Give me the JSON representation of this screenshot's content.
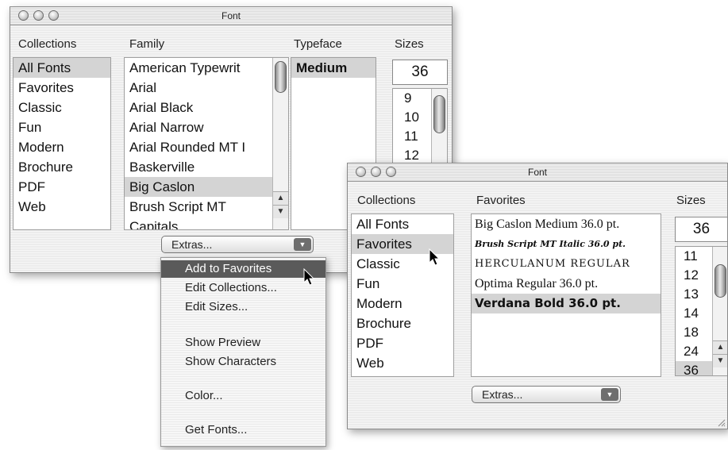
{
  "window1": {
    "title": "Font",
    "headers": {
      "collections": "Collections",
      "family": "Family",
      "typeface": "Typeface",
      "sizes": "Sizes"
    },
    "collections": [
      "All Fonts",
      "Favorites",
      "Classic",
      "Fun",
      "Modern",
      "Brochure",
      "PDF",
      "Web"
    ],
    "families": [
      "American Typewrit",
      "Arial",
      "Arial Black",
      "Arial Narrow",
      "Arial Rounded MT I",
      "Baskerville",
      "Big Caslon",
      "Brush Script MT",
      "Capitals"
    ],
    "typefaces": [
      "Medium"
    ],
    "size_value": "36",
    "sizes": [
      "9",
      "10",
      "11",
      "12"
    ],
    "extras_label": "Extras..."
  },
  "menu": {
    "items": [
      "Add to Favorites",
      "Edit Collections...",
      "Edit Sizes...",
      "Show Preview",
      "Show Characters",
      "Color...",
      "Get Fonts..."
    ]
  },
  "window2": {
    "title": "Font",
    "headers": {
      "collections": "Collections",
      "favorites": "Favorites",
      "sizes": "Sizes"
    },
    "collections": [
      "All Fonts",
      "Favorites",
      "Classic",
      "Fun",
      "Modern",
      "Brochure",
      "PDF",
      "Web"
    ],
    "favorites": [
      "Big Caslon Medium 36.0 pt.",
      "Brush Script MT Italic 36.0 pt.",
      "HERCULANUM REGULAR",
      "Optima Regular 36.0 pt.",
      "Verdana Bold 36.0 pt."
    ],
    "size_value": "36",
    "sizes": [
      "11",
      "12",
      "13",
      "14",
      "18",
      "24",
      "36"
    ],
    "extras_label": "Extras..."
  }
}
